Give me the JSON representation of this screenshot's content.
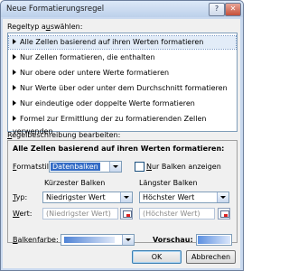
{
  "window": {
    "title": "Neue Formatierungsregel",
    "help_label": "?",
    "close_label": "✕"
  },
  "rule_type": {
    "heading_prefix": "Regeltyp a",
    "heading_accel": "u",
    "heading_suffix": "swählen:",
    "items": [
      "Alle Zellen basierend auf ihren Werten formatieren",
      "Nur Zellen formatieren, die enthalten",
      "Nur obere oder untere Werte formatieren",
      "Nur Werte über oder unter dem Durchschnitt formatieren",
      "Nur eindeutige oder doppelte Werte formatieren",
      "Formel zur Ermittlung der zu formatierenden Zellen verwenden"
    ],
    "selected_index": 0
  },
  "description": {
    "heading_accel": "R",
    "heading_suffix": "egelbeschreibung bearbeiten:",
    "title": "Alle Zellen basierend auf ihren Werten formatieren:",
    "format_style_accel": "F",
    "format_style_suffix": "ormatstil:",
    "format_style_value": "Datenbalken",
    "only_bar_accel": "N",
    "only_bar_suffix": "ur Balken anzeigen",
    "only_bar_checked": false,
    "shortest_bar_label": "Kürzester Balken",
    "longest_bar_label": "Längster Balken",
    "type_accel": "T",
    "type_suffix": "yp:",
    "shortest_type": "Niedrigster Wert",
    "longest_type": "Höchster Wert",
    "value_accel": "W",
    "value_suffix": "ert:",
    "shortest_value": "(Niedrigster Wert)",
    "longest_value": "(Höchster Wert)",
    "bar_color_accel": "B",
    "bar_color_suffix": "alkenfarbe:",
    "preview_label": "Vorschau:"
  },
  "colors": {
    "bar_color": "#4f83d6"
  },
  "buttons": {
    "ok": "OK",
    "cancel": "Abbrechen"
  }
}
